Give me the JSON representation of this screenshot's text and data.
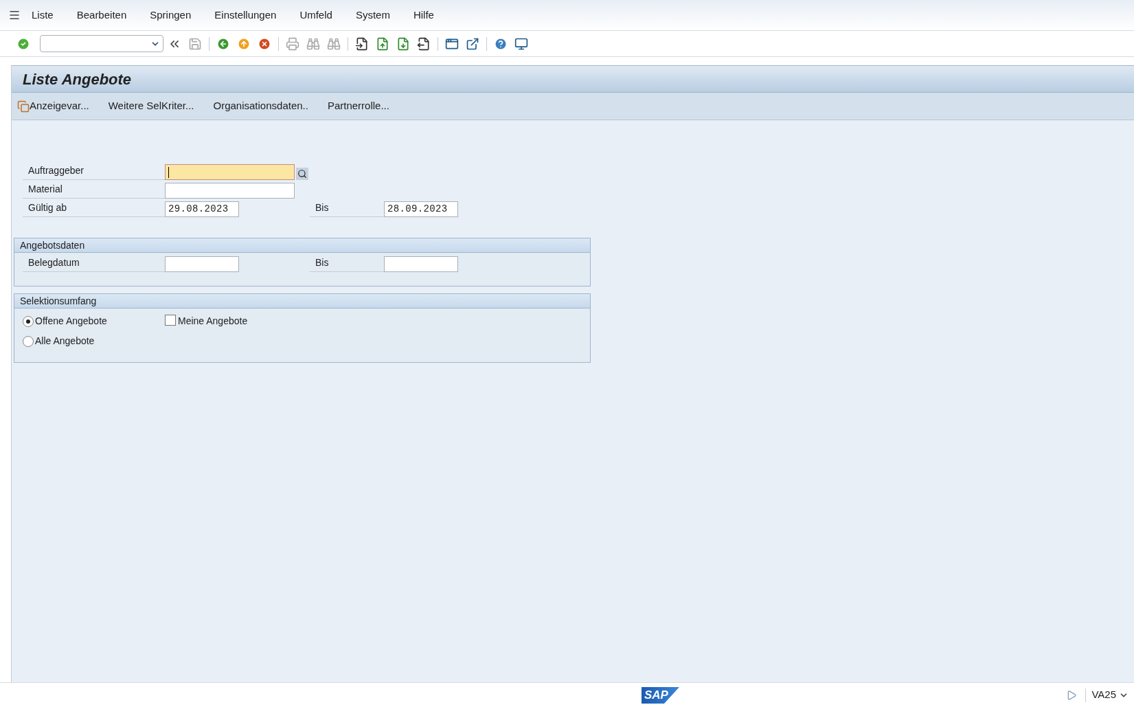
{
  "menu": [
    "Liste",
    "Bearbeiten",
    "Springen",
    "Einstellungen",
    "Umfeld",
    "System",
    "Hilfe"
  ],
  "title": "Liste Angebote",
  "app_toolbar": [
    {
      "label": "Anzeigevar...",
      "kind": "icon"
    },
    {
      "label": "Weitere SelKriter...",
      "kind": "plain"
    },
    {
      "label": "Organisationsdaten..",
      "kind": "plain"
    },
    {
      "label": "Partnerrolle...",
      "kind": "plain"
    }
  ],
  "fields": [
    {
      "label": "Auftraggeber",
      "kind": "focused"
    },
    {
      "label": "Material",
      "kind": "wide"
    },
    {
      "label": "Gültig ab",
      "kind": "date",
      "value": "29.08.2023",
      "to_label": "Bis",
      "to_value": "28.09.2023"
    }
  ],
  "angebotsdaten": {
    "title": "Angebotsdaten",
    "fields": [
      {
        "label": "Belegdatum",
        "to_label": "Bis"
      }
    ]
  },
  "selektionsumfang": {
    "title": "Selektionsumfang",
    "radios": [
      {
        "label": "Offene Angebote",
        "selected": true
      },
      {
        "label": "Alle Angebote",
        "selected": false
      }
    ],
    "checkbox": {
      "label": "Meine Angebote",
      "checked": false
    }
  },
  "status_bar": {
    "logo": "SAP",
    "transaction": "VA25"
  }
}
